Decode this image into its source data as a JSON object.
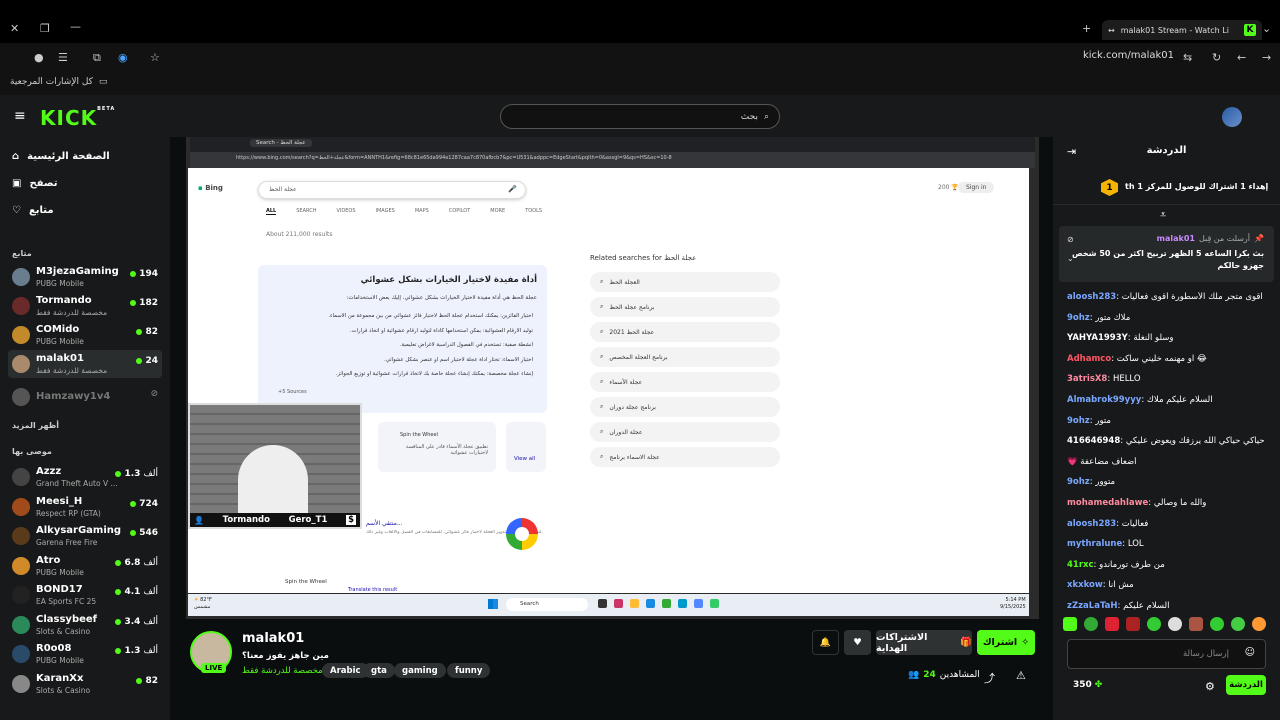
{
  "browser": {
    "tab_title": "malak01 Stream - Watch Li",
    "url": "kick.com/malak01",
    "bookmarks_label": "كل الإشارات المرجعية"
  },
  "header": {
    "logo": "KICK",
    "logo_beta": "BETA",
    "search_placeholder": "بحث"
  },
  "sidebar": {
    "nav": [
      {
        "label": "الصفحة الرئيسية",
        "icon": "home-icon"
      },
      {
        "label": "تصفح",
        "icon": "browse-icon"
      },
      {
        "label": "متابع",
        "icon": "heart-icon"
      }
    ],
    "following_label": "متابع",
    "following": [
      {
        "name": "M3jezaGaming",
        "game": "PUBG Mobile",
        "viewers": "194",
        "color": "#6a7d8f"
      },
      {
        "name": "Tormando",
        "game": "مخصصة للدردشة فقط",
        "viewers": "182",
        "color": "#6b2a2a"
      },
      {
        "name": "COMido",
        "game": "PUBG Mobile",
        "viewers": "82",
        "color": "#c28a2a"
      },
      {
        "name": "malak01",
        "game": "مخصصة للدردشة فقط",
        "viewers": "24",
        "color": "#a98a6a"
      }
    ],
    "offline": {
      "name": "Hamzawy1v4"
    },
    "show_more": "أظهر المزيد",
    "recommended_label": "موصى بها",
    "recommended": [
      {
        "name": "Azzz",
        "game": "Grand Theft Auto V ...",
        "viewers": "1.3",
        "unit": "ألف",
        "color": "#444"
      },
      {
        "name": "Meesi_H",
        "game": "Respect RP (GTA)",
        "viewers": "724",
        "unit": "",
        "color": "#a14a1a"
      },
      {
        "name": "AlkysarGaming",
        "game": "Garena Free Fire",
        "viewers": "546",
        "unit": "",
        "color": "#5a3a1a"
      },
      {
        "name": "Atro",
        "game": "PUBG Mobile",
        "viewers": "6.8",
        "unit": "ألف",
        "color": "#d08a2a"
      },
      {
        "name": "BOND17",
        "game": "EA Sports FC 25",
        "viewers": "4.1",
        "unit": "ألف",
        "color": "#222"
      },
      {
        "name": "Classybeef",
        "game": "Slots & Casino",
        "viewers": "3.4",
        "unit": "ألف",
        "color": "#2a8a5a"
      },
      {
        "name": "R0o08",
        "game": "PUBG Mobile",
        "viewers": "1.3",
        "unit": "ألف",
        "color": "#2a4a6a"
      },
      {
        "name": "KaranXx",
        "game": "Slots & Casino",
        "viewers": "82",
        "unit": "",
        "color": "#888"
      }
    ]
  },
  "stream_screen": {
    "browser_tab": "Search - عجلة الحظ",
    "url": "https://www.bing.com/search?q=عجلة+الحظ&form=ANNTH1&refig=68c81e65da994e1287caa7c870afbcb7&pc=U531&adppc=EdgeStart&pqlth=0&assgl=9&qs=HS&sc=10-8",
    "bing_logo": "Bing",
    "query": "عجلة الحظ",
    "tabs": [
      "ALL",
      "SEARCH",
      "VIDEOS",
      "IMAGES",
      "MAPS",
      "COPILOT",
      "MORE",
      "TOOLS"
    ],
    "results_count": "About 211,000 results",
    "ai_title": "أداة مفيدة لاختيار الخيارات بشكل عشوائي",
    "ai_intro": "عجلة الحظ هي أداة مفيدة لاختيار الخيارات بشكل عشوائي. إليك بعض الاستخدامات:",
    "ai_points": [
      "اختيار الفائزين: يمكنك استخدام عجلة الحظ لاختيار فائز عشوائي من بين مجموعة من الأسماء.",
      "توليد الأرقام العشوائية: يمكن استخدامها كأداة لتوليد أرقام عشوائية أو اتخاذ قرارات.",
      "أنشطة صفية: تستخدم في الفصول الدراسية لأغراض تعليمية.",
      "اختيار الأسماء: تختار أداة عجلة لاختيار اسم أو عنصر بشكل عشوائي.",
      "إنشاء عجلة مخصصة: يمكنك إنشاء عجلة خاصة بك لاتخاذ قرارات عشوائية أو توزيع الجوائز."
    ],
    "ai_sources": "+5 Sources",
    "card1_title": "Spin the Wheel",
    "card1_text": "تطبيق عجلة الأسماء قادر على المنافسة لاختيارات عشوائية",
    "card2_text": "View all",
    "related_title": "Related searches for عجلة الحظ",
    "related": [
      "العجلة الحظ",
      "برنامج عجلة الحظ",
      "عجلة الحظ 2021",
      "برنامج العجلة المخصص",
      "عجلة الأسماء",
      "برنامج عجلة دوران",
      "عجلة الدوران",
      "عجلة الاسماء برنامج"
    ],
    "result_title": "منتقي الأسم...",
    "result_text": "لتحل الأسماء وقم بتدوير العجلة لاختيار فائز عشوائي. للمسابقات في الفصل والألعاب وغير ذلك.",
    "result2_title": "Spin the Wheel",
    "result2_link": "Translate this result",
    "taskbar_search": "Search",
    "weather_temp": "82°F",
    "weather_text": "مشمس",
    "clock_time": "5:14 PM",
    "clock_date": "9/15/2025",
    "webcam_left": "Tormando",
    "webcam_right": "Gero_T1",
    "webcam_badge": "$"
  },
  "stream_info": {
    "streamer": "malak01",
    "live_badge": "LIVE",
    "title": "مين جاهز يفوز معنا؟",
    "category": "مخصصة للدردشة فقط",
    "tags": [
      "Arabic",
      "gta",
      "gaming",
      "funny"
    ],
    "viewers_label": "المشاهدين",
    "viewers": "24",
    "subscribe_label": "اشتراك",
    "gift_label": "الاشتراكات الهداية"
  },
  "chat": {
    "header": "الدردشة",
    "goal": "إهداء 1 اشتراك للوصول للمركز 1 th",
    "goal_rank": "1",
    "pinned_user": "malak01",
    "pinned_meta": "أرسلت من قِبل",
    "pinned_text": "بث بكرا الساعه 5 الظهر تربيح اكثر من 50 شخص جهزو حالكم",
    "messages": [
      {
        "user": "aloosh283",
        "text": "اقوى متجر ملك الأسطورة اقوى فعاليات",
        "color": "#7aa7ff"
      },
      {
        "user": "9ohz",
        "text": "ملاك متور",
        "color": "#7aa7ff"
      },
      {
        "user": "YAHYA1993Y",
        "text": "وسلو النغلة",
        "color": "#ffffff"
      },
      {
        "user": "Adhamco",
        "text": "او مهنمه خليني ساكت 😂",
        "color": "#ff5566"
      },
      {
        "user": "3atrisX8",
        "text": "HELLO",
        "color": "#ff8aa0"
      },
      {
        "user": "Almabrok99yyy",
        "text": "السلام عليكم ملاك",
        "color": "#7aa7ff"
      },
      {
        "user": "9ohz",
        "text": "متور",
        "color": "#7aa7ff"
      },
      {
        "user": "416646948",
        "text": "حياكي حياكي الله يرزقك ويعوض عليكي",
        "color": "#ffffff"
      },
      {
        "user": "",
        "text": "💗 أضعاف مضاعفة",
        "color": "#ffffff"
      },
      {
        "user": "9ohz",
        "text": "متوور",
        "color": "#7aa7ff"
      },
      {
        "user": "mohamedahlawe",
        "text": "والله ما وصالي",
        "color": "#ff8aa0"
      },
      {
        "user": "aloosh283",
        "text": "فعاليات",
        "color": "#7aa7ff"
      },
      {
        "user": "mythralune",
        "text": "LOL",
        "color": "#7aa7ff"
      },
      {
        "user": "41rxc",
        "text": "من طرف تورماندو",
        "color": "#53fc18"
      },
      {
        "user": "xkxkow",
        "text": "مش انا",
        "color": "#7aa7ff"
      },
      {
        "user": "zZzaLaTaH",
        "text": "السلام عليكم",
        "color": "#7aa7ff"
      }
    ],
    "input_placeholder": "إرسال رسالة",
    "points": "350",
    "send_label": "الدردشة"
  },
  "colors": {
    "brand": "#53fc18",
    "bg": "#0b0e0f",
    "panel": "#18191a"
  }
}
